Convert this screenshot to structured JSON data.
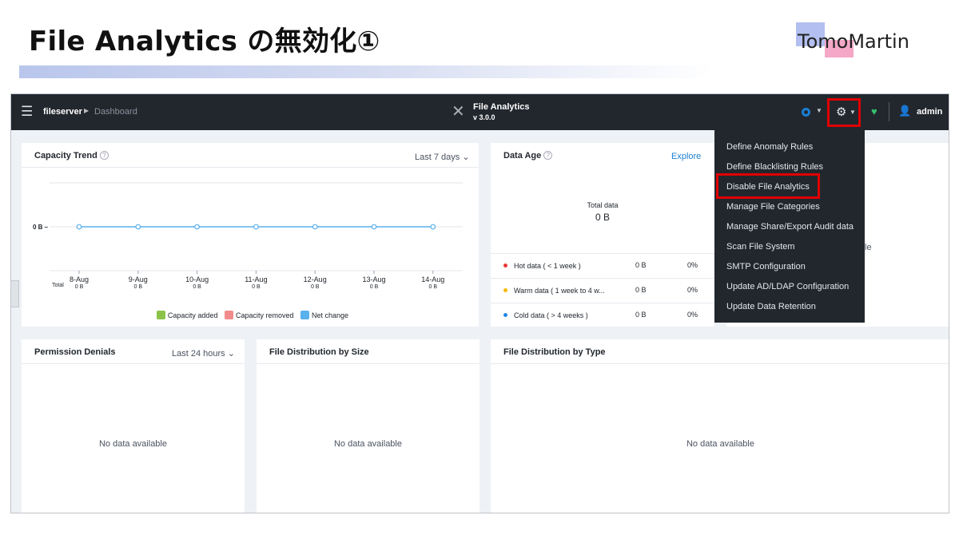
{
  "slide": {
    "title": "File Analytics の無効化①",
    "logo_text": "TomoMartin"
  },
  "topbar": {
    "menu_icon": "hamburger-icon",
    "cluster_name": "fileserver",
    "breadcrumb_page": "Dashboard",
    "app_name": "File Analytics",
    "app_version": "v 3.0.0",
    "user": "admin",
    "health_color": "#37c06b"
  },
  "capacity_trend": {
    "title": "Capacity Trend",
    "range": "Last 7 days",
    "total_label": "Total",
    "chart_data": {
      "type": "line",
      "categories": [
        "8-Aug",
        "9-Aug",
        "10-Aug",
        "11-Aug",
        "12-Aug",
        "13-Aug",
        "14-Aug"
      ],
      "totals": [
        "0 B",
        "0 B",
        "0 B",
        "0 B",
        "0 B",
        "0 B",
        "0 B"
      ],
      "series": [
        {
          "name": "Net change",
          "values": [
            0,
            0,
            0,
            0,
            0,
            0,
            0
          ],
          "color": "#5ab0ec"
        }
      ],
      "y_tick_label": "0 B",
      "legend": [
        {
          "name": "Capacity added",
          "color": "#8bc34a"
        },
        {
          "name": "Capacity removed",
          "color": "#f28c8c"
        },
        {
          "name": "Net change",
          "color": "#5ab0ec"
        }
      ],
      "legend_position": "bottom",
      "grid": true
    }
  },
  "data_age": {
    "title": "Data Age",
    "explore": "Explore",
    "total_label": "Total data",
    "total_value": "0 B",
    "rows": [
      {
        "label": "Hot data ( < 1 week )",
        "size": "0 B",
        "percent": "0%",
        "color": "#e53935"
      },
      {
        "label": "Warm data ( 1 week to 4 w...",
        "size": "0 B",
        "percent": "0%",
        "color": "#f5b800"
      },
      {
        "label": "Cold data ( > 4 weeks )",
        "size": "0 B",
        "percent": "0%",
        "color": "#1e88e5"
      }
    ]
  },
  "partial_panel_text": "le",
  "settings_menu": {
    "items": [
      "Define Anomaly Rules",
      "Define Blacklisting Rules",
      "Disable File Analytics",
      "Manage File Categories",
      "Manage Share/Export Audit data",
      "Scan File System",
      "SMTP Configuration",
      "Update AD/LDAP Configuration",
      "Update Data Retention"
    ]
  },
  "permission_denials": {
    "title": "Permission Denials",
    "range": "Last 24 hours",
    "empty": "No data available"
  },
  "file_dist_size": {
    "title": "File Distribution by Size",
    "empty": "No data available"
  },
  "file_dist_type": {
    "title": "File Distribution by Type",
    "empty": "No data available"
  }
}
